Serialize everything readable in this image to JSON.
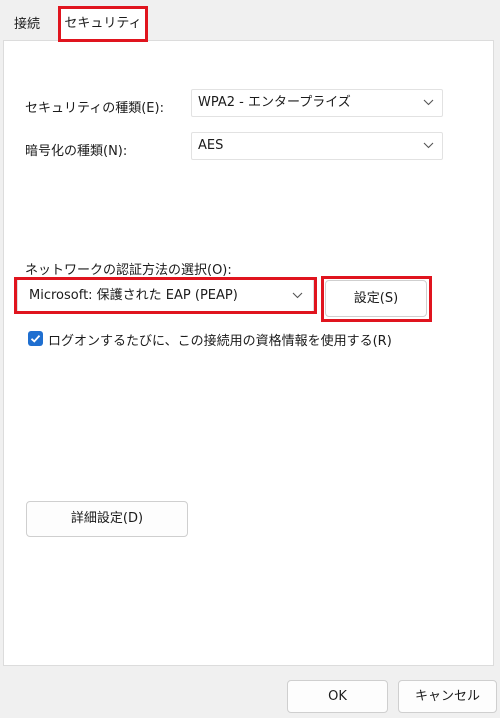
{
  "tabs": {
    "connection_label": "接続",
    "security_label": "セキュリティ"
  },
  "security": {
    "type_label": "セキュリティの種類(E):",
    "type_value": "WPA2 - エンタープライズ",
    "encryption_label": "暗号化の種類(N):",
    "encryption_value": "AES"
  },
  "auth": {
    "method_label": "ネットワークの認証方法の選択(O):",
    "method_value": "Microsoft: 保護された EAP (PEAP)",
    "settings_button": "設定(S)",
    "remember_checkbox_label": "ログオンするたびに、この接続用の資格情報を使用する(R)",
    "remember_checked": true
  },
  "advanced_button": "詳細設定(D)",
  "footer": {
    "ok_label": "OK",
    "cancel_label": "キャンセル"
  },
  "colors": {
    "highlight": "#e0141e",
    "checkbox": "#1f6fd0"
  }
}
